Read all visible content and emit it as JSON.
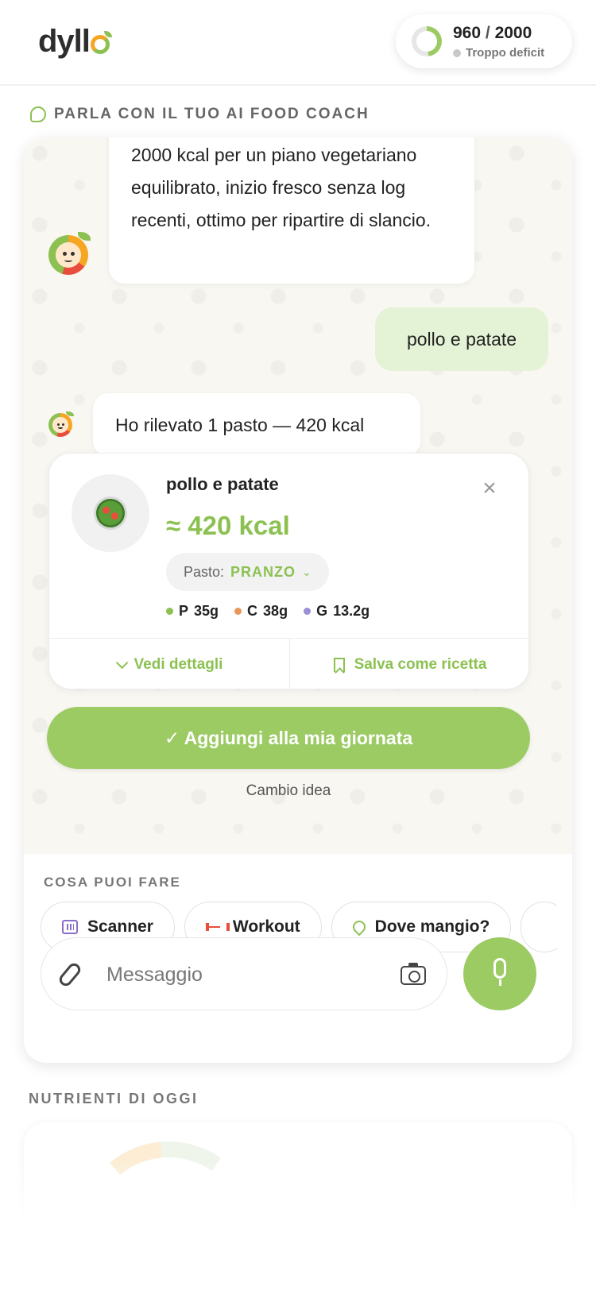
{
  "header": {
    "logo_text": "dyll",
    "calories": {
      "consumed": "960",
      "separator": "/",
      "target": "2000",
      "consumed_value": 960,
      "target_value": 2000,
      "status": "Troppo deficit"
    }
  },
  "chat_section": {
    "label": "PARLA CON IL TUO AI FOOD COACH",
    "messages": [
      {
        "from": "bot",
        "text": "2000 kcal per un piano vegetariano equilibrato, inizio fresco senza log recenti, ottimo per ripartire di slancio."
      },
      {
        "from": "user",
        "text": "pollo e patate"
      },
      {
        "from": "bot",
        "text": "Ho rilevato 1 pasto — 420 kcal"
      }
    ],
    "meal_card": {
      "title": "pollo e patate",
      "kcal": "≈ 420 kcal",
      "meal_type_label": "Pasto:",
      "meal_type_value": "PRANZO",
      "macros": [
        {
          "letter": "P",
          "value": "35g",
          "color": "#8cc152"
        },
        {
          "letter": "C",
          "value": "38g",
          "color": "#e8965a"
        },
        {
          "letter": "G",
          "value": "13.2g",
          "color": "#9b8fd6"
        }
      ],
      "details_label": "Vedi dettagli",
      "save_label": "Salva come ricetta"
    },
    "add_button_label": "✓ Aggiungi alla mia giornata",
    "change_mind_label": "Cambio idea"
  },
  "actions": {
    "label": "COSA PUOI FARE",
    "chips": [
      {
        "label": "Scanner",
        "icon": "scanner-icon"
      },
      {
        "label": "Workout",
        "icon": "dumbbell-icon"
      },
      {
        "label": "Dove mangio?",
        "icon": "map-pin-icon"
      }
    ]
  },
  "composer": {
    "placeholder": "Messaggio"
  },
  "nutrients": {
    "label": "NUTRIENTI DI OGGI"
  },
  "colors": {
    "accent": "#9ccb64",
    "accent_text": "#8cc152",
    "user_bubble": "#e4f3d5"
  }
}
